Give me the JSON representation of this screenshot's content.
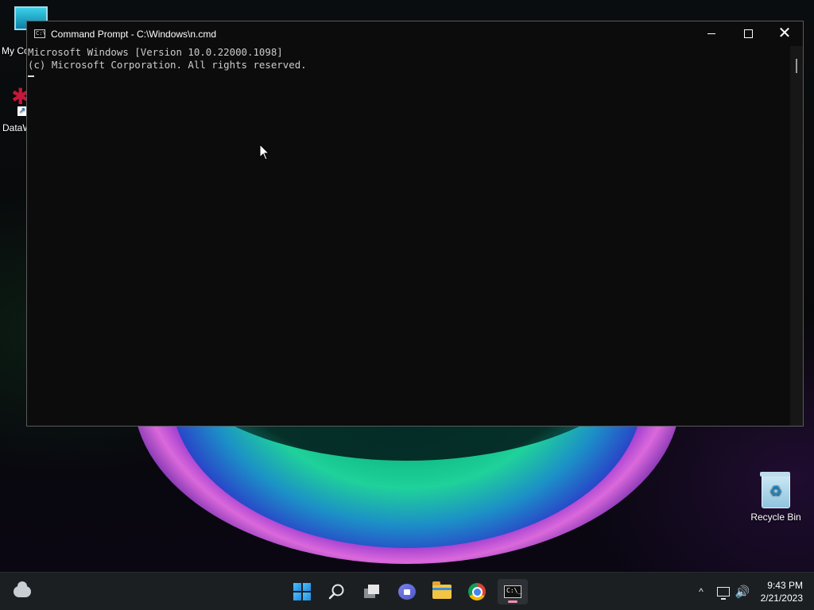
{
  "desktop": {
    "icons": [
      {
        "label": "My Co"
      },
      {
        "label": "DataW"
      },
      {
        "label": "Recycle Bin"
      }
    ]
  },
  "window": {
    "title": "Command Prompt - C:\\Windows\\n.cmd",
    "title_icon_text": "C:\\",
    "controls": {
      "minimize": "minimize",
      "maximize": "maximize",
      "close": "✕"
    }
  },
  "console": {
    "lines": [
      "Microsoft Windows [Version 10.0.22000.1098]",
      "(c) Microsoft Corporation. All rights reserved."
    ]
  },
  "taskbar": {
    "apps": [
      "weather",
      "start",
      "search",
      "task-view",
      "chat",
      "file-explorer",
      "chrome",
      "command-prompt"
    ],
    "active_app": "command-prompt",
    "cmd_glyph": "C:\\_",
    "tray_chevron": "^",
    "volume_icon": "🔊",
    "time": "9:43 PM",
    "date": "2/21/2023"
  },
  "colors": {
    "console_bg": "#0c0c0c",
    "console_text": "#cccccc",
    "taskbar_bg": "#1c1f22",
    "accent_pink": "#f48fb1"
  }
}
